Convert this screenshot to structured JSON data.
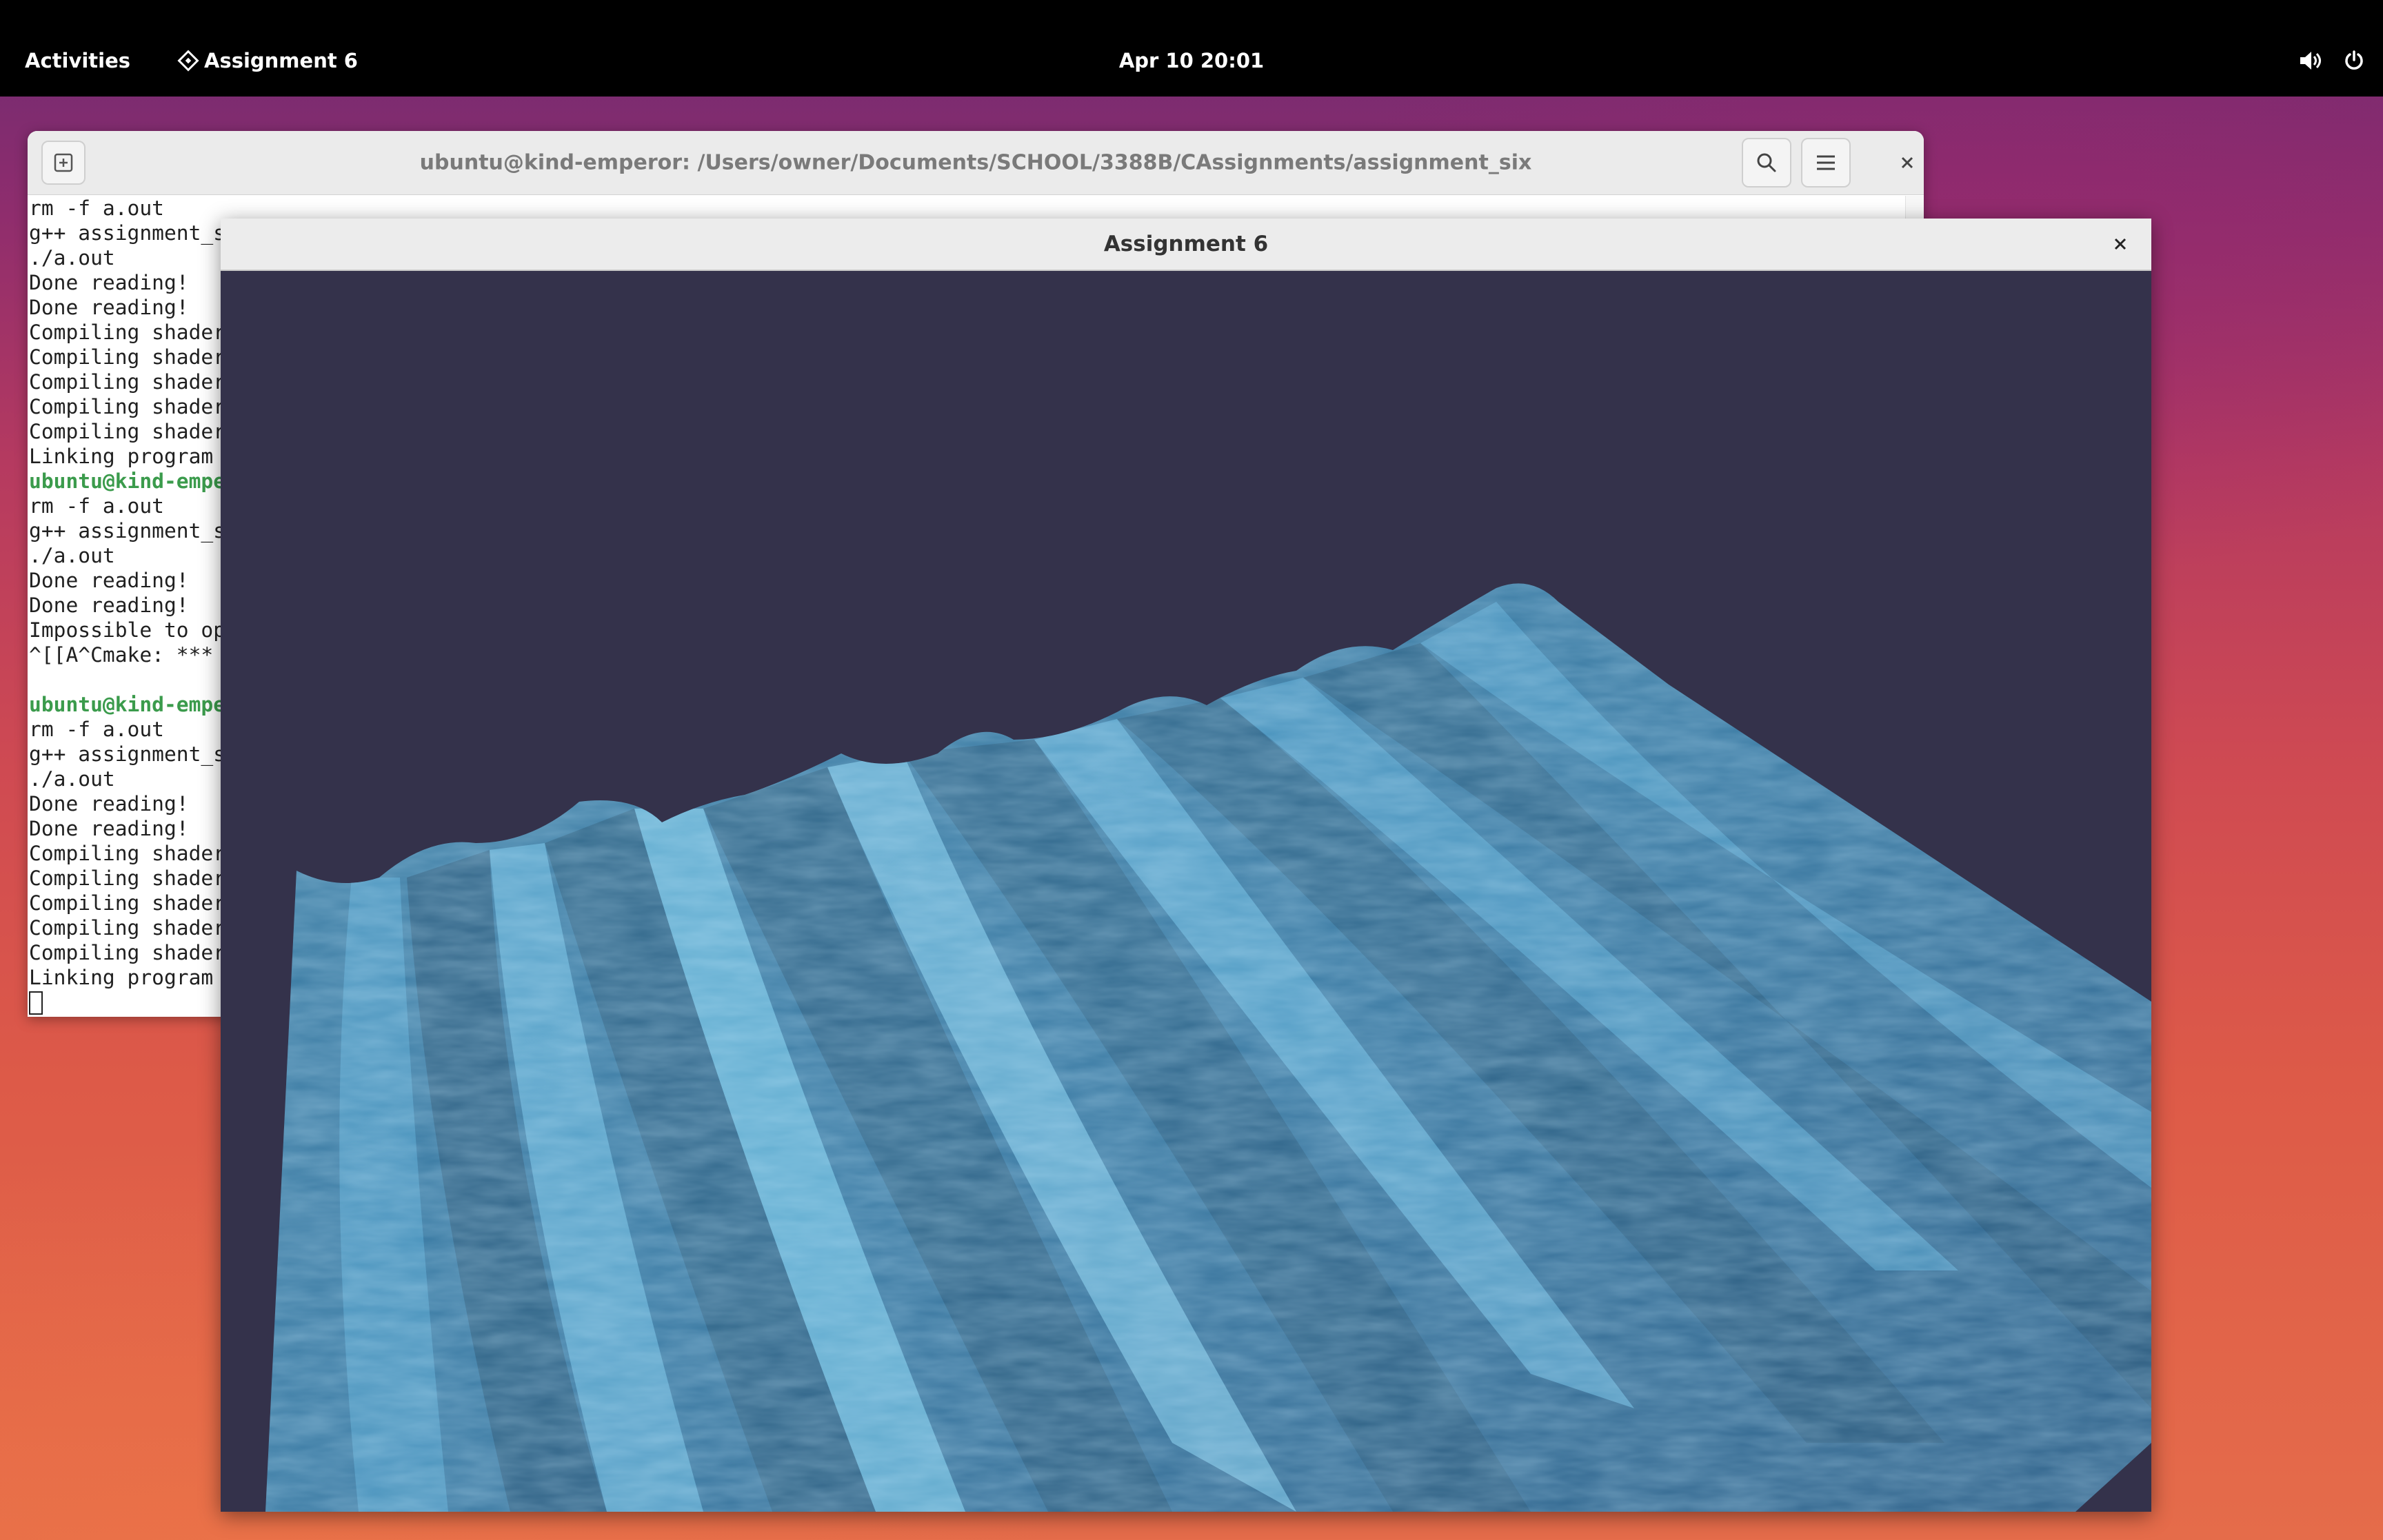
{
  "topbar": {
    "activities": "Activities",
    "app_name": "Assignment 6",
    "clock": "Apr 10  20:01",
    "icons": [
      "volume-icon",
      "power-icon"
    ]
  },
  "terminal": {
    "title": "ubuntu@kind-emperor: /Users/owner/Documents/SCHOOL/3388B/CAssignments/assignment_six",
    "icons": [
      "new-tab-icon",
      "search-icon",
      "hamburger-menu-icon",
      "close-icon"
    ],
    "lines": [
      {
        "text": "rm -f a.out",
        "prompt": false
      },
      {
        "text": "g++ assignment_s",
        "prompt": false
      },
      {
        "text": "./a.out",
        "prompt": false
      },
      {
        "text": "Done reading!",
        "prompt": false
      },
      {
        "text": "Done reading!",
        "prompt": false
      },
      {
        "text": "Compiling shader",
        "prompt": false
      },
      {
        "text": "Compiling shader",
        "prompt": false
      },
      {
        "text": "Compiling shader",
        "prompt": false
      },
      {
        "text": "Compiling shader",
        "prompt": false
      },
      {
        "text": "Compiling shader",
        "prompt": false
      },
      {
        "text": "Linking program",
        "prompt": false
      },
      {
        "text": "ubuntu@kind-empe",
        "prompt": true
      },
      {
        "text": "rm -f a.out",
        "prompt": false
      },
      {
        "text": "g++ assignment_s",
        "prompt": false
      },
      {
        "text": "./a.out",
        "prompt": false
      },
      {
        "text": "Done reading!",
        "prompt": false
      },
      {
        "text": "Done reading!",
        "prompt": false
      },
      {
        "text": "Impossible to op",
        "prompt": false
      },
      {
        "text": "^[[A^Cmake: ***",
        "prompt": false
      },
      {
        "text": "",
        "prompt": false
      },
      {
        "text": "ubuntu@kind-empe",
        "prompt": true
      },
      {
        "text": "rm -f a.out",
        "prompt": false
      },
      {
        "text": "g++ assignment_s",
        "prompt": false
      },
      {
        "text": "./a.out",
        "prompt": false
      },
      {
        "text": "Done reading!",
        "prompt": false
      },
      {
        "text": "Done reading!",
        "prompt": false
      },
      {
        "text": "Compiling shader",
        "prompt": false
      },
      {
        "text": "Compiling shader",
        "prompt": false
      },
      {
        "text": "Compiling shader",
        "prompt": false
      },
      {
        "text": "Compiling shader",
        "prompt": false
      },
      {
        "text": "Compiling shader",
        "prompt": false
      },
      {
        "text": "Linking program",
        "prompt": false
      }
    ]
  },
  "gl_window": {
    "title": "Assignment 6",
    "close_icon": "close-icon",
    "colors": {
      "background": "#34324b",
      "water_dark": "#2d5a78",
      "water_mid": "#3a7ea8",
      "water_light": "#7fd0f0"
    }
  }
}
